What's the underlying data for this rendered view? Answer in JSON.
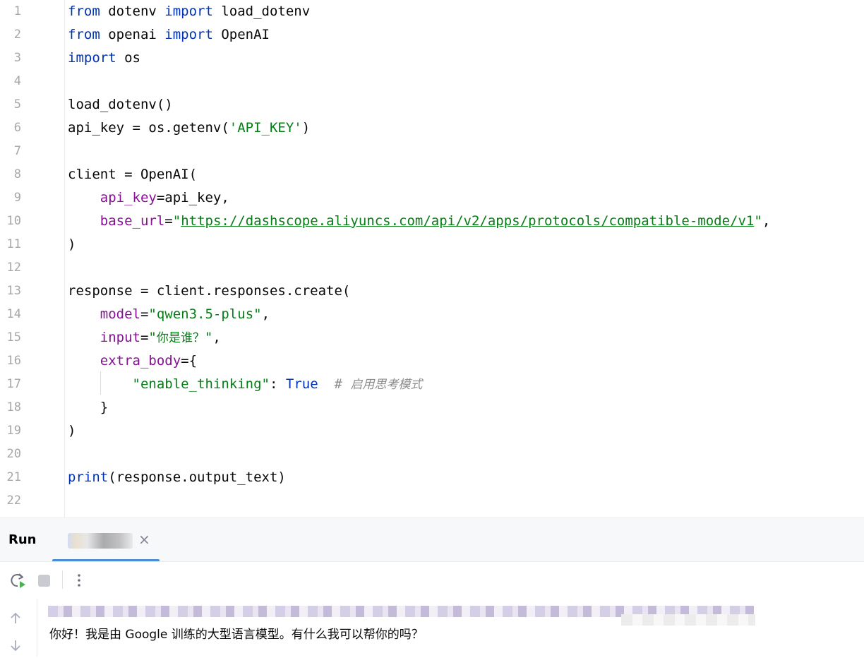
{
  "editor": {
    "line_numbers": [
      "1",
      "2",
      "3",
      "4",
      "5",
      "6",
      "7",
      "8",
      "9",
      "10",
      "11",
      "12",
      "13",
      "14",
      "15",
      "16",
      "17",
      "18",
      "19",
      "20",
      "21",
      "22"
    ],
    "tokens": {
      "l1_kw1": "from",
      "l1_t1": " dotenv ",
      "l1_kw2": "import",
      "l1_t2": " load_dotenv",
      "l2_kw1": "from",
      "l2_t1": " openai ",
      "l2_kw2": "import",
      "l2_t2": " OpenAI",
      "l3_kw1": "import",
      "l3_t1": " os",
      "l5_t1": "load_dotenv()",
      "l6_t1": "api_key = os.getenv(",
      "l6_s1": "'API_KEY'",
      "l6_t2": ")",
      "l8_t1": "client = OpenAI(",
      "l9_ind": "    ",
      "l9_p1": "api_key",
      "l9_t1": "=api_key,",
      "l10_ind": "    ",
      "l10_p1": "base_url",
      "l10_t1": "=",
      "l10_q1": "\"",
      "l10_u1": "https://dashscope.aliyuncs.com/api/v2/apps/protocols/compatible-mode/v1",
      "l10_q2": "\"",
      "l10_t2": ",",
      "l11_t1": ")",
      "l13_t1": "response = client.responses.create(",
      "l14_ind": "    ",
      "l14_p1": "model",
      "l14_t1": "=",
      "l14_s1": "\"qwen3.5-plus\"",
      "l14_t2": ",",
      "l15_ind": "    ",
      "l15_p1": "input",
      "l15_t1": "=",
      "l15_s1": "\"",
      "l15_s2": "你是谁？",
      "l15_s3": "\"",
      "l15_t2": ",",
      "l16_ind": "    ",
      "l16_p1": "extra_body",
      "l16_t1": "={",
      "l17_ind": "        ",
      "l17_s1": "\"enable_thinking\"",
      "l17_t1": ": ",
      "l17_kw1": "True",
      "l17_t2": "  ",
      "l17_c1": "# ",
      "l17_c2": "启用思考模式",
      "l18_ind": "    ",
      "l18_t1": "}",
      "l19_t1": ")",
      "l21_kw1": "print",
      "l21_t1": "(response.output_text)"
    }
  },
  "run_panel": {
    "title": "Run",
    "tab_close": "×"
  },
  "toolbar": {
    "rerun_icon": "rerun-icon",
    "stop_icon": "stop-icon",
    "more_icon": "more-vertical-icon",
    "more_glyph": "⋮"
  },
  "console": {
    "output_line": "你好！我是由 Google 训练的大型语言模型。有什么我可以帮你的吗？",
    "up_icon": "arrow-up-icon",
    "down_icon": "arrow-down-icon"
  },
  "colors": {
    "keyword": "#0033b3",
    "string": "#067d17",
    "param": "#871094",
    "comment": "#8c8c8c",
    "accent": "#4c8bd6",
    "run_green": "#4fb04f"
  }
}
